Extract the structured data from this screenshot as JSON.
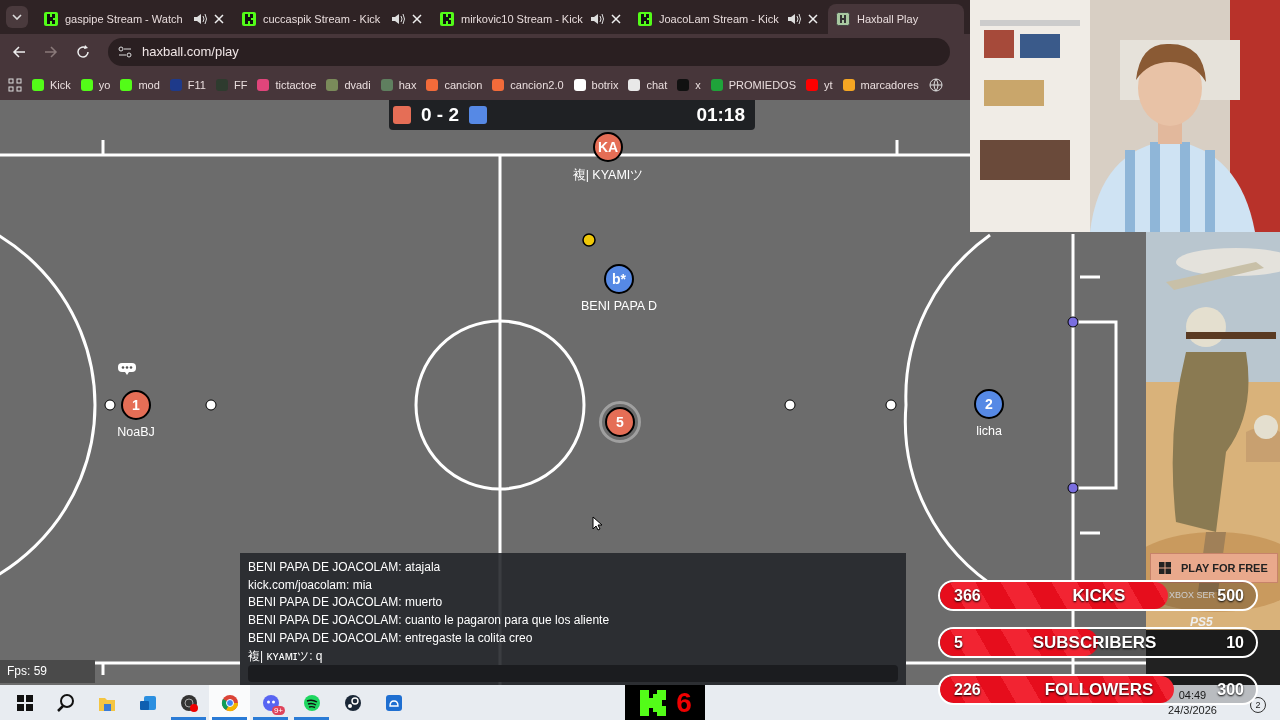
{
  "browser": {
    "tabs": [
      {
        "title": "gaspipe Stream - Watch",
        "audio": true,
        "selected": false
      },
      {
        "title": "cuccaspik Stream - Kick",
        "audio": true,
        "selected": false
      },
      {
        "title": "mirkovic10 Stream - Kick",
        "audio": true,
        "selected": false
      },
      {
        "title": "JoacoLam Stream - Kick",
        "audio": true,
        "selected": false
      },
      {
        "title": "Haxball Play",
        "audio": false,
        "selected": true
      }
    ],
    "address": "haxball.com/play",
    "bookmarks": [
      {
        "label": "Kick",
        "color": "#53fc18"
      },
      {
        "label": "yo",
        "color": "#53fc18"
      },
      {
        "label": "mod",
        "color": "#53fc18"
      },
      {
        "label": "F11",
        "color": "#1e3a8a"
      },
      {
        "label": "FF",
        "color": "#2e3b2e"
      },
      {
        "label": "tictactoe",
        "color": "#e0457b"
      },
      {
        "label": "dvadi",
        "color": "#7a8a5a"
      },
      {
        "label": "hax",
        "color": "#5f7f5f"
      },
      {
        "label": "cancion",
        "color": "#f26b3a"
      },
      {
        "label": "cancion2.0",
        "color": "#f26b3a"
      },
      {
        "label": "botrix",
        "color": "#ffffff"
      },
      {
        "label": "chat",
        "color": "#e8e8e8"
      },
      {
        "label": "x",
        "color": "#111111"
      },
      {
        "label": "PROMIEDOS",
        "color": "#1fa33a"
      },
      {
        "label": "yt",
        "color": "#ff0000"
      },
      {
        "label": "marcadores",
        "color": "#f5a623"
      }
    ]
  },
  "game": {
    "score": {
      "red": "0",
      "separator": "-",
      "blue": "2",
      "time": "01:18"
    },
    "players": [
      {
        "label": "KA",
        "name": "複| KYAMIツ",
        "color": "#e56e56",
        "controlled": false,
        "chatting": false
      },
      {
        "label": "b*",
        "name": "BENI PAPA D",
        "color": "#5689e5",
        "controlled": false,
        "chatting": false
      },
      {
        "label": "1",
        "name": "NoaBJ",
        "color": "#e56e56",
        "controlled": false,
        "chatting": true
      },
      {
        "label": "5",
        "color": "#e56e56",
        "controlled": true,
        "chatting": false
      },
      {
        "label": "2",
        "name": "licha",
        "color": "#5689e5",
        "controlled": false,
        "chatting": false
      }
    ],
    "chat": {
      "messages": [
        "BENI PAPA DE JOACOLAM: atajala",
        "kick.com/joacolam: mia",
        "BENI PAPA DE JOACOLAM: muerto",
        "BENI PAPA DE JOACOLAM: cuanto le pagaron para que los aliente",
        "BENI PAPA DE JOACOLAM: entregaste la colita creo",
        "複| ᴋʏᴀᴍɪツ: q"
      ]
    },
    "fps": "Fps: 59"
  },
  "ad": {
    "kind": "picture",
    "button": "PLAY FOR FREE",
    "platform_1": "XBOX SER",
    "platform_2": "PS5"
  },
  "goals": [
    {
      "count": "366",
      "label": "KICKS",
      "target": "500",
      "level": 0.72
    },
    {
      "count": "5",
      "label": "SUBSCRIBERS",
      "target": "10",
      "level": 0.5
    },
    {
      "count": "226",
      "label": "FOLLOWERS",
      "target": "300",
      "level": 0.74
    }
  ],
  "taskbar": {
    "apps": [
      {
        "running": false,
        "active": false
      },
      {
        "running": false,
        "active": false
      },
      {
        "running": false,
        "active": false
      },
      {
        "running": false,
        "active": false
      },
      {
        "running": true,
        "active": false
      },
      {
        "running": true,
        "active": true
      },
      {
        "running": true,
        "active": false,
        "badge": "9+"
      },
      {
        "running": true,
        "active": false
      },
      {
        "running": false,
        "active": false
      },
      {
        "running": false,
        "active": false
      }
    ],
    "kick_counter": "6",
    "time": "04:49",
    "date": "24/3/2026",
    "notifications": "2"
  }
}
